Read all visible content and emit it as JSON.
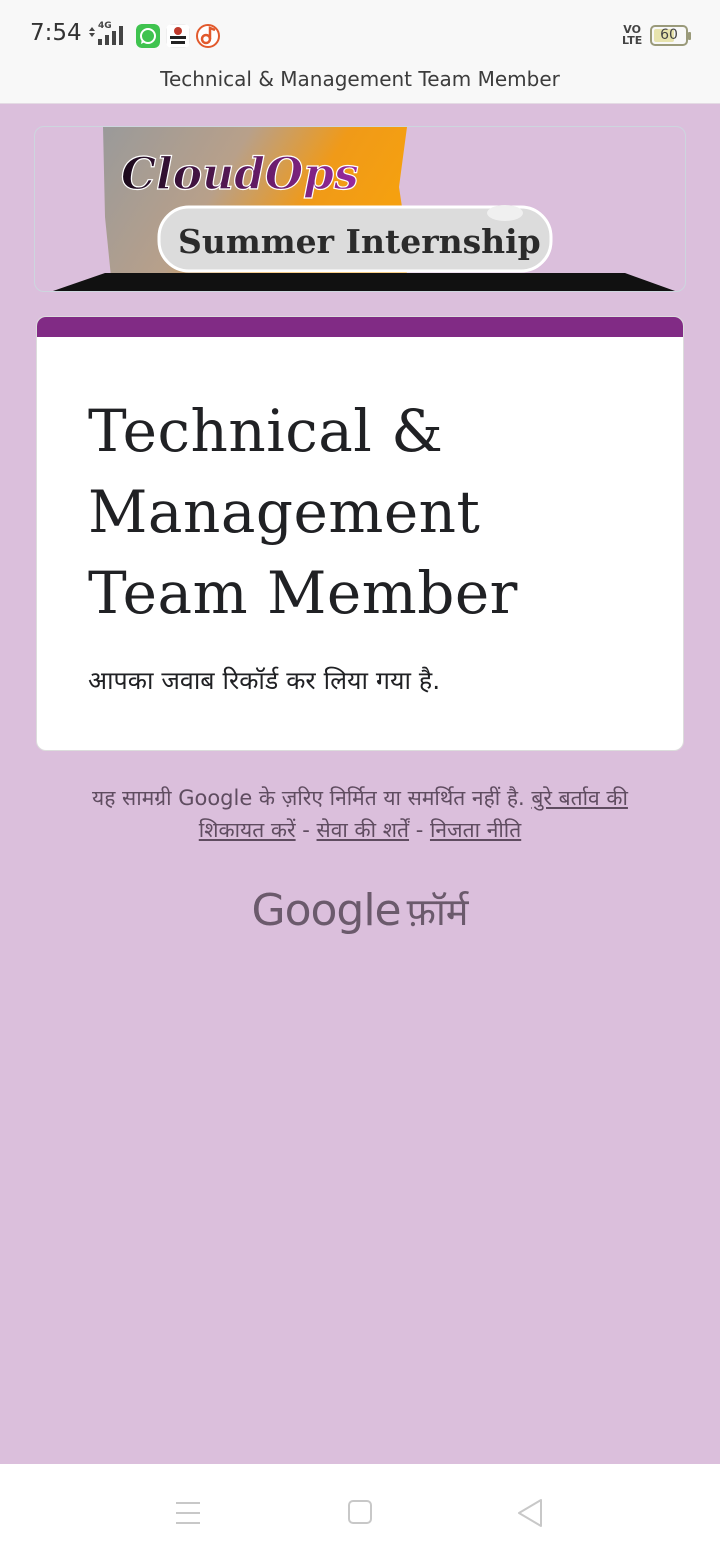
{
  "status_bar": {
    "time": "7:54",
    "network": "4G",
    "volte": "VO\nLTE",
    "battery": "60",
    "battery_level": 0.6,
    "app_icons": [
      "whatsapp-icon",
      "news-app-icon",
      "music-app-icon"
    ]
  },
  "app_bar": {
    "title": "Technical & Management Team Member"
  },
  "banner": {
    "line1": "CloudOps",
    "line2": "Summer Internship"
  },
  "card": {
    "title": "Technical & Management Team Member",
    "message": "आपका जवाब रिकॉर्ड कर लिया गया है."
  },
  "footer": {
    "disclaimer": "यह सामग्री Google के ज़रिए निर्मित या समर्थित नहीं है.",
    "link_abuse_a": "बुरे बर्ताव की",
    "link_abuse_b": "शिकायत करें",
    "sep": " - ",
    "link_terms": "सेवा की शर्तें",
    "link_privacy": "निजता नीति"
  },
  "brand": {
    "google": "Google",
    "forms": "फ़ॉर्म"
  },
  "colors": {
    "background": "#dbbfdc",
    "accent": "#812b85",
    "text_muted": "#5f4c60"
  }
}
